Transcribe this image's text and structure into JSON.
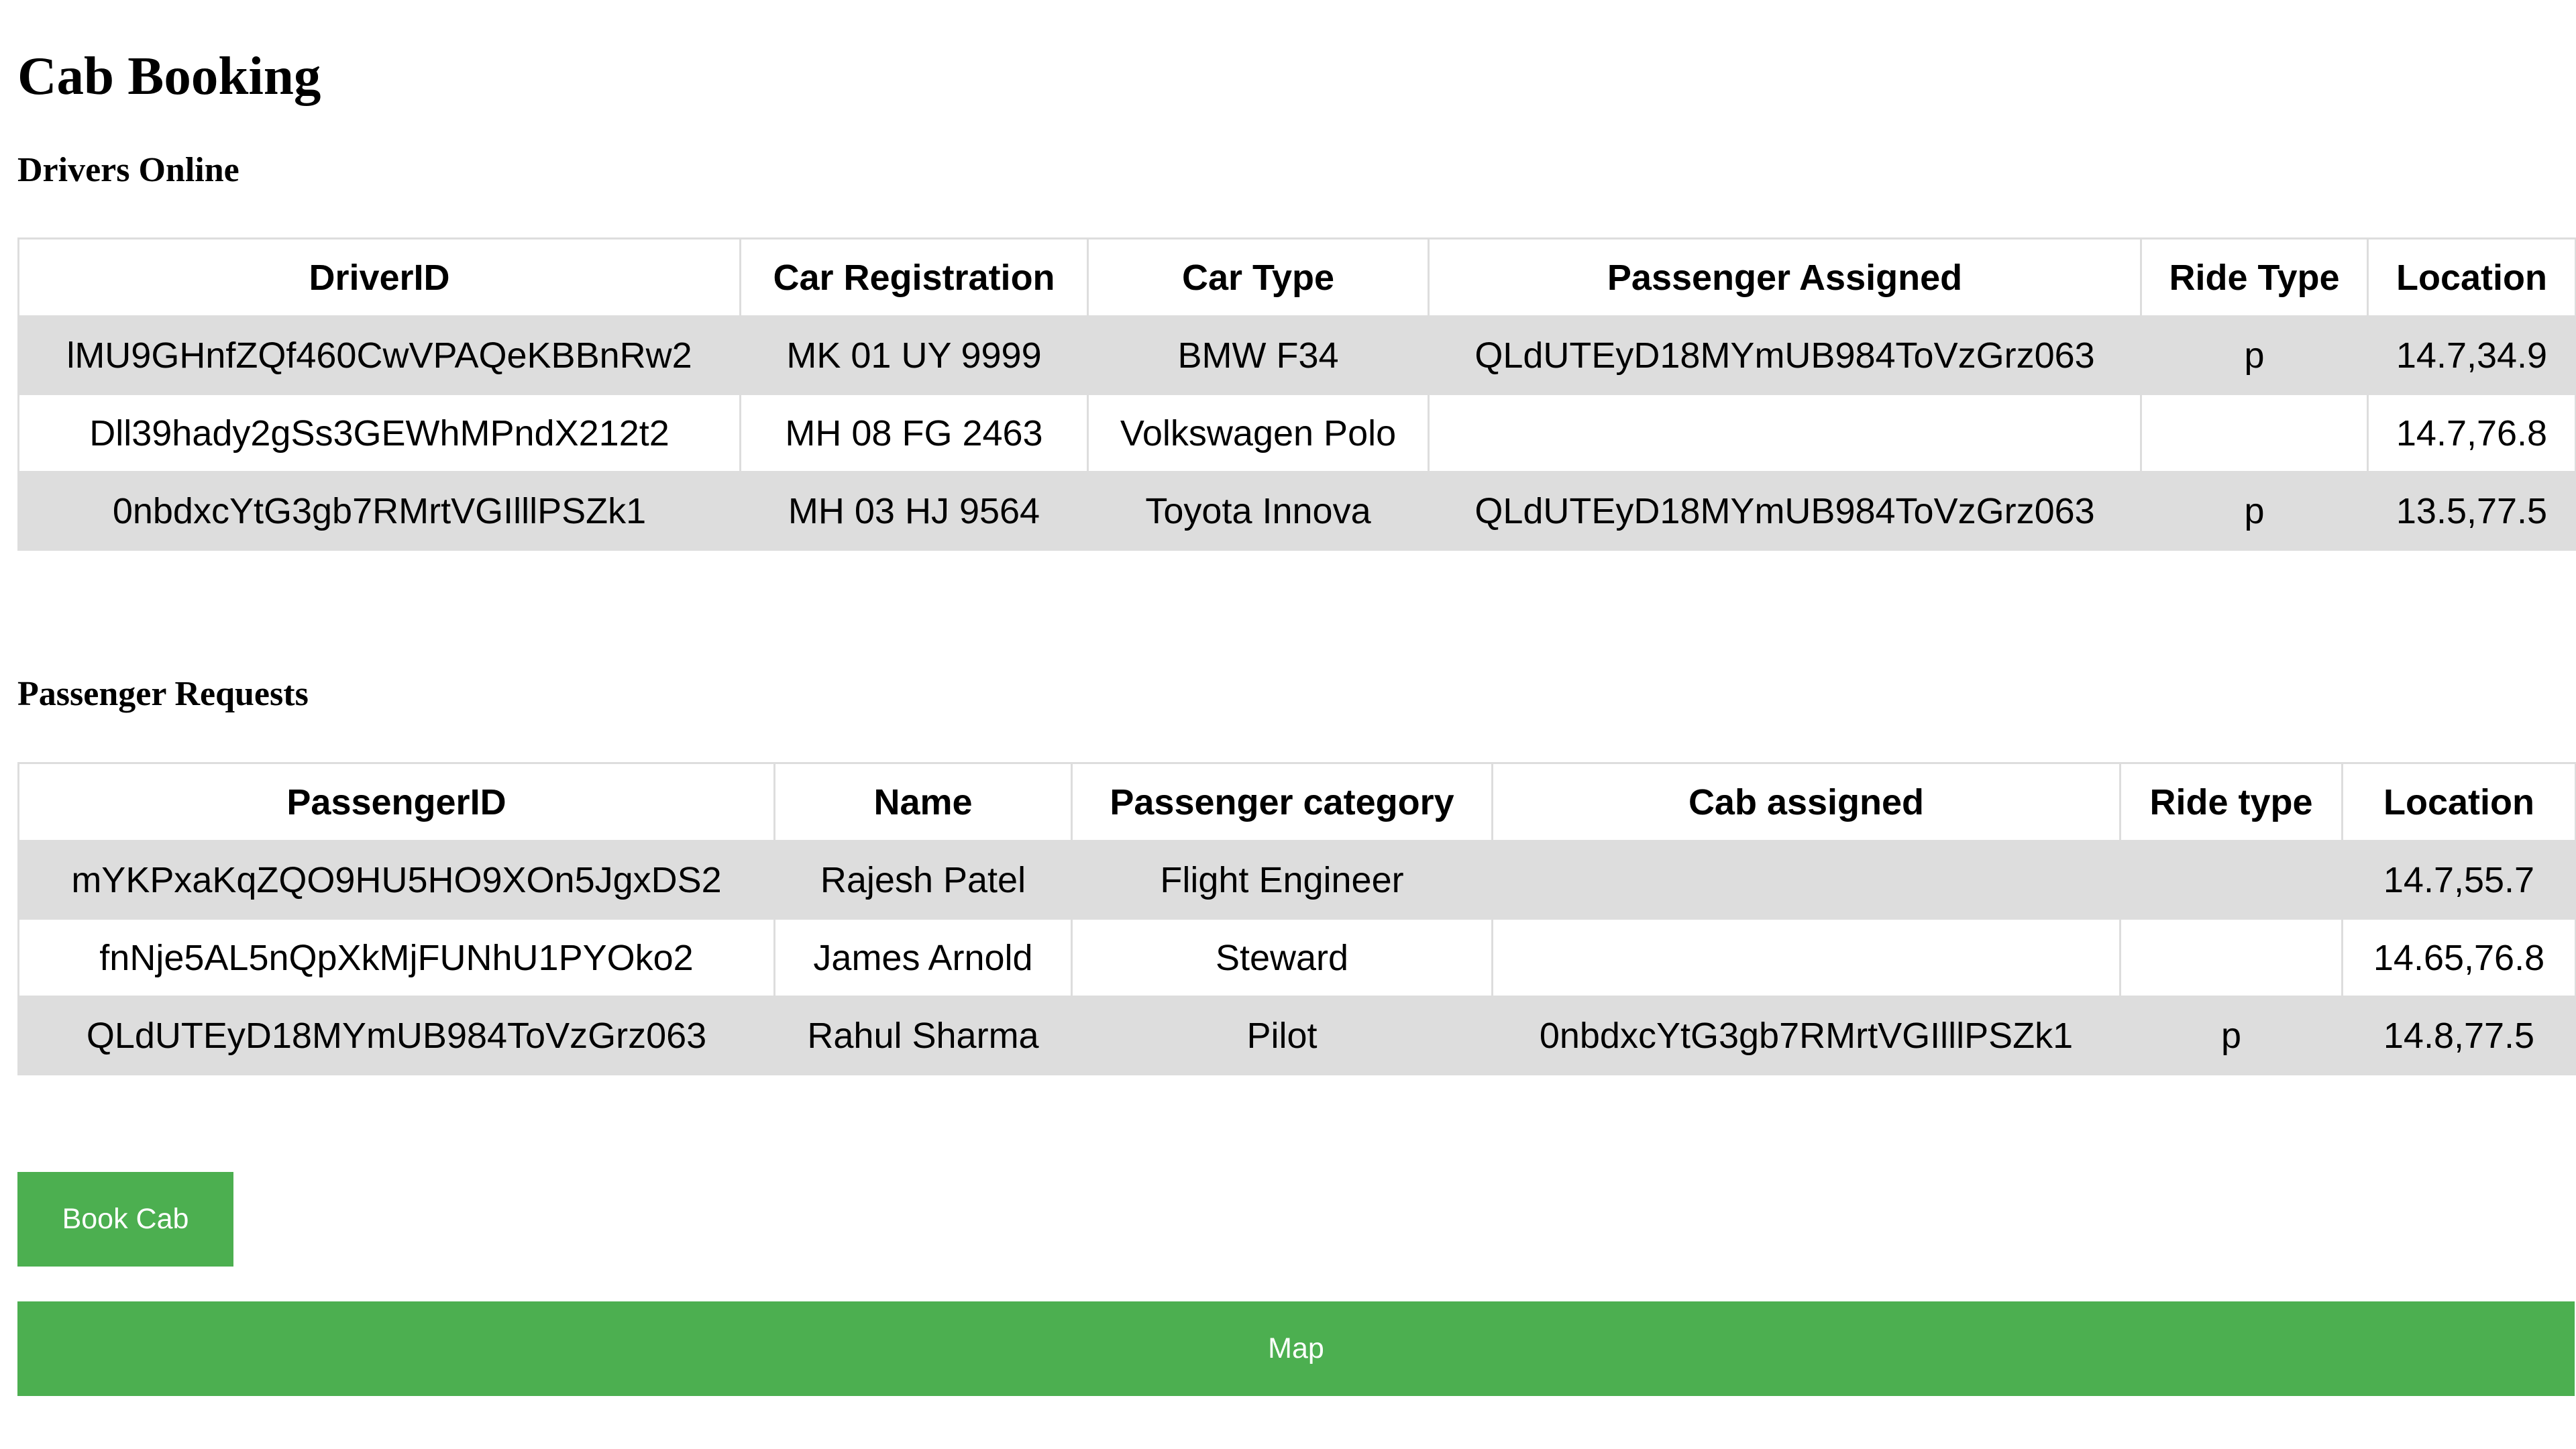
{
  "page": {
    "title": "Cab Booking"
  },
  "drivers": {
    "heading": "Drivers Online",
    "columns": [
      "DriverID",
      "Car Registration",
      "Car Type",
      "Passenger Assigned",
      "Ride Type",
      "Location"
    ],
    "rows": [
      [
        "lMU9GHnfZQf460CwVPAQeKBBnRw2",
        "MK 01 UY 9999",
        "BMW F34",
        "QLdUTEyD18MYmUB984ToVzGrz063",
        "p",
        "14.7,34.9"
      ],
      [
        "Dll39hady2gSs3GEWhMPndX212t2",
        "MH 08 FG 2463",
        "Volkswagen Polo",
        "",
        "",
        "14.7,76.8"
      ],
      [
        "0nbdxcYtG3gb7RMrtVGIlllPSZk1",
        "MH 03 HJ 9564",
        "Toyota Innova",
        "QLdUTEyD18MYmUB984ToVzGrz063",
        "p",
        "13.5,77.5"
      ]
    ]
  },
  "passengers": {
    "heading": "Passenger Requests",
    "columns": [
      "PassengerID",
      "Name",
      "Passenger category",
      "Cab assigned",
      "Ride type",
      "Location"
    ],
    "rows": [
      [
        "mYKPxaKqZQO9HU5HO9XOn5JgxDS2",
        "Rajesh Patel",
        "Flight Engineer",
        "",
        "",
        "14.7,55.7"
      ],
      [
        "fnNje5AL5nQpXkMjFUNhU1PYOko2",
        "James Arnold",
        "Steward",
        "",
        "",
        "14.65,76.8"
      ],
      [
        "QLdUTEyD18MYmUB984ToVzGrz063",
        "Rahul Sharma",
        "Pilot",
        "0nbdxcYtG3gb7RMrtVGIlllPSZk1",
        "p",
        "14.8,77.5"
      ]
    ]
  },
  "actions": {
    "book_cab_label": "Book Cab",
    "map_label": "Map"
  },
  "colors": {
    "button_bg": "#4caf50",
    "button_text": "#ffffff",
    "stripe_row": "#dddddd",
    "border": "#dddddd"
  }
}
